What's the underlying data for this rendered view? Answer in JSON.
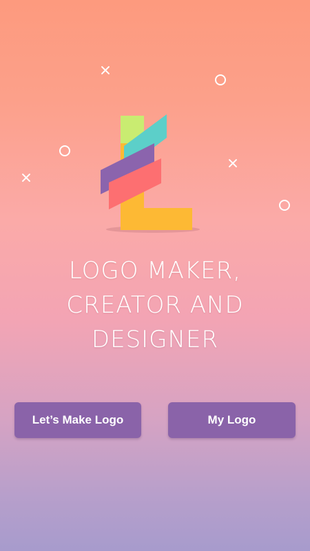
{
  "app": {
    "title_line1": "LOGO MAKER,",
    "title_line2": "CREATOR AND DESIGNER",
    "logo_letter": "L"
  },
  "actions": {
    "make_logo_label": "Let’s Make Logo",
    "my_logo_label": "My Logo"
  },
  "colors": {
    "button_bg": "#8a63a9",
    "logo_yellow": "#fdb934",
    "logo_green": "#c9ec71",
    "logo_teal": "#5ccfc9",
    "logo_purple": "#8b64ad",
    "logo_red": "#fd6f71"
  },
  "decorations": [
    "cross-icon",
    "ring-icon"
  ]
}
